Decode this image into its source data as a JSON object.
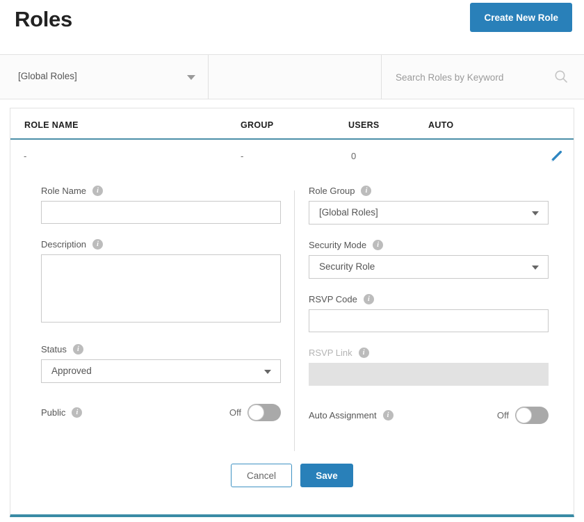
{
  "header": {
    "title": "Roles",
    "create_button": "Create New Role"
  },
  "filter_bar": {
    "role_group_filter": {
      "selected": "[Global Roles]",
      "icon": "chevron-down-icon"
    },
    "search": {
      "value": "",
      "placeholder": "Search Roles by Keyword",
      "icon": "search-icon"
    }
  },
  "table": {
    "columns": [
      "ROLE NAME",
      "GROUP",
      "USERS",
      "AUTO"
    ],
    "rows": [
      {
        "role_name": "-",
        "group": "-",
        "users": "0",
        "auto": "",
        "edit_icon": "pencil-icon"
      }
    ]
  },
  "edit_panel": {
    "left": {
      "role_name": {
        "label": "Role Name",
        "value": "",
        "placeholder": "",
        "info_icon": "info-icon"
      },
      "description": {
        "label": "Description",
        "value": "",
        "placeholder": "",
        "info_icon": "info-icon"
      },
      "status": {
        "label": "Status",
        "selected": "Approved",
        "info_icon": "info-icon",
        "caret_icon": "chevron-down-icon"
      },
      "public": {
        "label": "Public",
        "state": "Off",
        "info_icon": "info-icon"
      }
    },
    "right": {
      "role_group": {
        "label": "Role Group",
        "selected": "[Global Roles]",
        "info_icon": "info-icon",
        "caret_icon": "chevron-down-icon"
      },
      "security_mode": {
        "label": "Security Mode",
        "selected": "Security Role",
        "info_icon": "info-icon",
        "caret_icon": "chevron-down-icon"
      },
      "rsvp_code": {
        "label": "RSVP Code",
        "value": "",
        "placeholder": "",
        "info_icon": "info-icon"
      },
      "rsvp_link": {
        "label": "RSVP Link",
        "value": "",
        "disabled": true,
        "info_icon": "info-icon"
      },
      "auto_assignment": {
        "label": "Auto Assignment",
        "state": "Off",
        "info_icon": "info-icon"
      }
    },
    "actions": {
      "cancel": "Cancel",
      "save": "Save"
    }
  },
  "colors": {
    "accent_blue": "#2980b9",
    "header_underline": "#4b8fa8",
    "panel_bottom": "#3a8ba5",
    "info_icon_gray": "#bcbcbc",
    "toggle_track": "#a9a9a9"
  }
}
